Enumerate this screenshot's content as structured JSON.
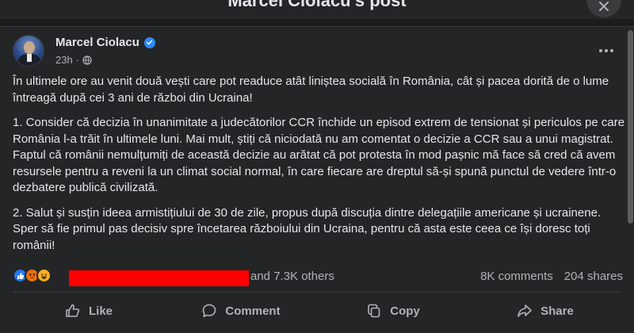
{
  "dialog": {
    "title": "Marcel Ciolacu's post"
  },
  "post": {
    "author": "Marcel Ciolacu",
    "time": "23h",
    "paragraphs": [
      "În ultimele ore au venit două vești care pot readuce atât liniștea socială în România, cât și pacea dorită de o lume întreagă după cei 3 ani de război din Ucraina!",
      "1. Consider că decizia în unanimitate a judecătorilor CCR închide un episod extrem de tensionat și periculos pe care România l-a trăit în ultimele luni. Mai mult, știți că niciodată nu am comentat o decizie a CCR sau a unui magistrat. Faptul că românii nemulțumiți de această decizie au arătat că pot protesta în mod pașnic mă face să cred că avem resursele pentru a reveni la un climat social normal, în care fiecare are dreptul să-și spună punctul de vedere într-o dezbatere publică civilizată.",
      "2. Salut și susțin ideea armistițiului de 30 de zile, propus după discuția dintre delegațiile americane și ucrainene. Sper să fie primul pas decisiv spre încetarea războiului din Ucraina, pentru că asta este ceea ce își doresc toți românii!"
    ]
  },
  "engagement": {
    "others": "and 7.3K others",
    "comments": "8K comments",
    "shares": "204 shares"
  },
  "actions": {
    "like": "Like",
    "comment": "Comment",
    "copy": "Copy",
    "share": "Share"
  },
  "colors": {
    "background": "#242526",
    "text": "#e4e6eb",
    "secondary_text": "#b0b3b8",
    "verified": "#2d88ff",
    "redaction": "#ff0000"
  },
  "icons": [
    "close-icon",
    "verified-icon",
    "globe-icon",
    "more-icon",
    "like-reaction-icon",
    "angry-reaction-icon",
    "haha-reaction-icon",
    "like-icon",
    "comment-icon",
    "copy-icon",
    "share-icon"
  ]
}
